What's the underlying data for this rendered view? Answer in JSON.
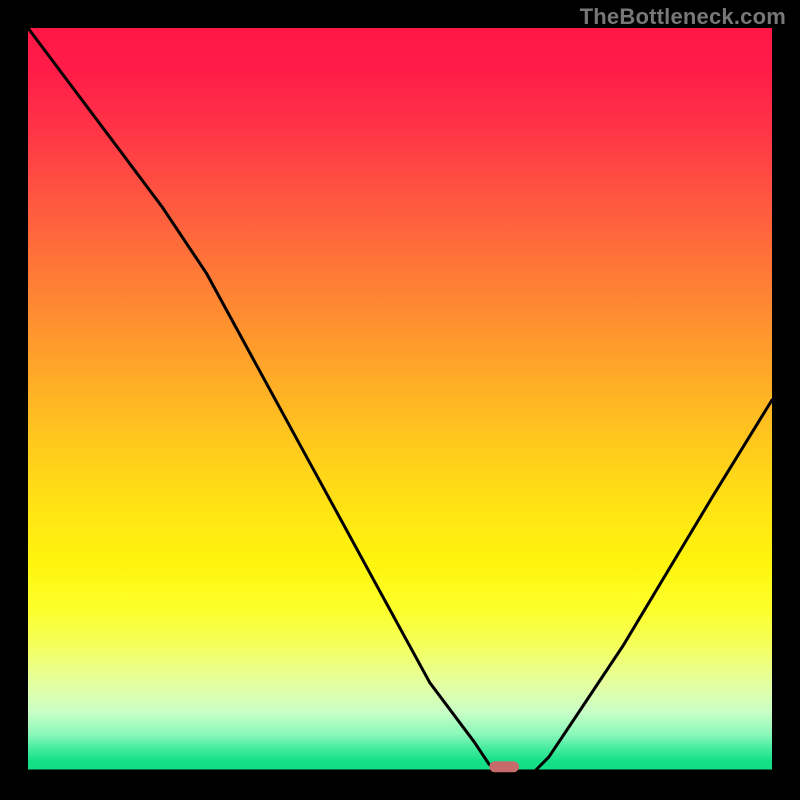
{
  "watermark": "TheBottleneck.com",
  "chart_data": {
    "type": "line",
    "title": "",
    "xlabel": "",
    "ylabel": "",
    "xlim": [
      0,
      100
    ],
    "ylim": [
      0,
      100
    ],
    "grid": false,
    "legend": false,
    "series": [
      {
        "name": "bottleneck-curve",
        "x": [
          0,
          6,
          12,
          18,
          24,
          30,
          36,
          42,
          48,
          54,
          60,
          62,
          64,
          66,
          68,
          70,
          74,
          80,
          86,
          92,
          100
        ],
        "values": [
          100,
          92,
          84,
          76,
          67,
          56,
          45,
          34,
          23,
          12,
          4,
          1,
          0,
          0,
          0,
          2,
          8,
          17,
          27,
          37,
          50
        ]
      }
    ],
    "optimal_region": {
      "x_start": 62,
      "x_end": 66,
      "y": 0.7
    },
    "background_gradient": {
      "top": "#ff1746",
      "upper_mid": "#ffa02b",
      "mid": "#ffe214",
      "lower_mid": "#e6ffa0",
      "bottom": "#0fdc85"
    }
  }
}
